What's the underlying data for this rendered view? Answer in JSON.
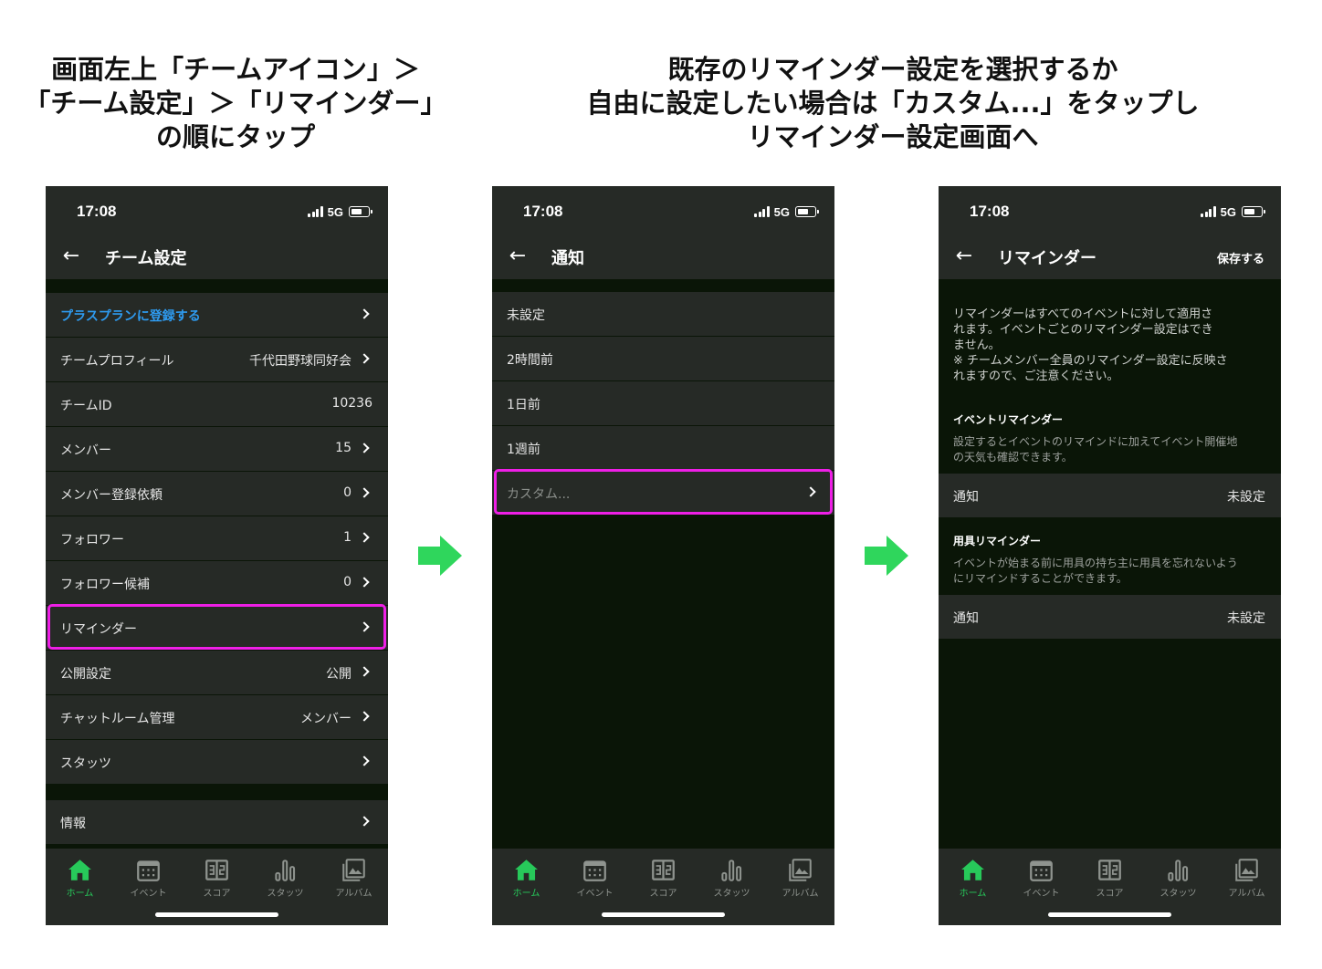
{
  "headings": {
    "left": [
      "画面左上「チームアイコン」＞",
      "「チーム設定」＞「リマインダー」",
      "の順にタップ"
    ],
    "right": [
      "既存のリマインダー設定を選択するか",
      "自由に設定したい場合は「カスタム...」をタップし",
      "リマインダー設定画面へ"
    ]
  },
  "status": {
    "time": "17:08",
    "network": "5G"
  },
  "tabs": [
    {
      "label": "ホーム",
      "icon": "home-icon"
    },
    {
      "label": "イベント",
      "icon": "calendar-icon"
    },
    {
      "label": "スコア",
      "icon": "score-icon"
    },
    {
      "label": "スタッツ",
      "icon": "bar-chart-icon"
    },
    {
      "label": "アルバム",
      "icon": "album-icon"
    }
  ],
  "screen1": {
    "title": "チーム設定",
    "rows": [
      {
        "label": "プラスプランに登録する",
        "value": ""
      },
      {
        "label": "チームプロフィール",
        "value": "千代田野球同好会"
      },
      {
        "label": "チームID",
        "value": "10236"
      },
      {
        "label": "メンバー",
        "value": "15"
      },
      {
        "label": "メンバー登録依頼",
        "value": "0"
      },
      {
        "label": "フォロワー",
        "value": "1"
      },
      {
        "label": "フォロワー候補",
        "value": "0"
      },
      {
        "label": "リマインダー",
        "value": ""
      },
      {
        "label": "公開設定",
        "value": "公開"
      },
      {
        "label": "チャットルーム管理",
        "value": "メンバー"
      },
      {
        "label": "スタッツ",
        "value": ""
      }
    ],
    "info_row": {
      "label": "情報"
    }
  },
  "screen2": {
    "title": "通知",
    "rows": [
      {
        "label": "未設定"
      },
      {
        "label": "2時間前"
      },
      {
        "label": "1日前"
      },
      {
        "label": "1週前"
      },
      {
        "label": "カスタム..."
      }
    ]
  },
  "screen3": {
    "title": "リマインダー",
    "save_label": "保存する",
    "description": [
      "リマインダーはすべてのイベントに対して適用さ",
      "れます。イベントごとのリマインダー設定はでき",
      "ません。",
      "※ チームメンバー全員のリマインダー設定に反映さ",
      "れますので、ご注意ください。"
    ],
    "event_section": {
      "title": "イベントリマインダー",
      "description": [
        "設定するとイベントのリマインドに加えてイベント開催地",
        "の天気も確認できます。"
      ],
      "row_label": "通知",
      "row_value": "未設定"
    },
    "equipment_section": {
      "title": "用具リマインダー",
      "description": [
        "イベントが始まる前に用具の持ち主に用具を忘れないよう",
        "にリマインドすることができます。"
      ],
      "row_label": "通知",
      "row_value": "未設定"
    }
  },
  "colors": {
    "highlight": "#ee1fe6",
    "accent_blue": "#2e9bf0",
    "active_green": "#27c95a",
    "arrow_green": "#2fd65c",
    "row_background": "#262a26",
    "screen_background": "#0a1507"
  }
}
